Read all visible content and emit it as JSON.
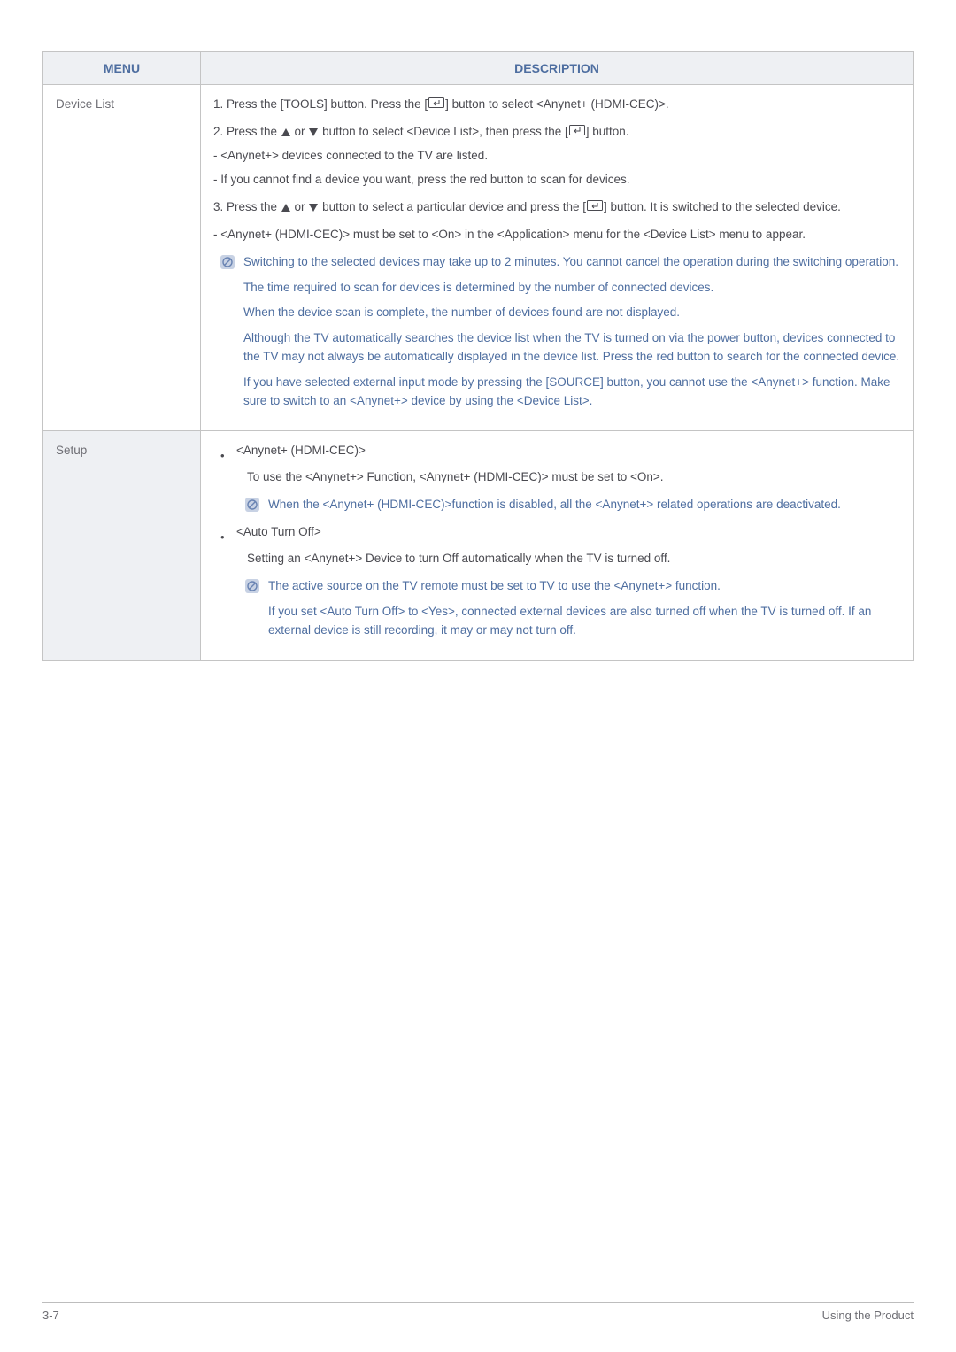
{
  "table": {
    "header": {
      "menu": "MENU",
      "description": "DESCRIPTION"
    },
    "rows": [
      {
        "menu": "Device List",
        "p1a": "1. Press the [TOOLS] button. Press the [",
        "p1b": "] button to select <Anynet+ (HDMI-CEC)>.",
        "p2a": "2. Press the ",
        "p2b": " or ",
        "p2c": " button to select <Device List>, then press the [",
        "p2d": "] button.",
        "p3": " - <Anynet+> devices connected to the TV are listed.",
        "p4": " - If you cannot find a device you want, press the red button to scan for devices.",
        "p5a": "3. Press the ",
        "p5b": " or ",
        "p5c": " button to select a particular device and press the [",
        "p5d": "] button. It is switched to the selected device.",
        "p6": " - <Anynet+ (HDMI-CEC)> must be set to <On> in the <Application> menu for the <Device List> menu to appear.",
        "n1": "Switching to the selected devices may take up to 2 minutes. You cannot cancel the operation during the switching operation.",
        "n2": "The time required to scan for devices is determined by the number of connected devices.",
        "n3": "When the device scan is complete, the number of devices found are not displayed.",
        "n4": "Although the TV automatically searches the device list when the TV is turned on via the power button, devices connected to the TV may not always be automatically displayed in the device list. Press the red button to search for the connected device.",
        "n5": "If you have selected external input mode by pressing the [SOURCE] button, you cannot use the <Anynet+> function. Make sure to switch to an <Anynet+> device by using the <Device List>."
      },
      {
        "menu": "Setup",
        "b1_title": "<Anynet+ (HDMI-CEC)>",
        "b1_sub": "To use the <Anynet+> Function, <Anynet+ (HDMI-CEC)> must be set to <On>.",
        "b1_note": "When the <Anynet+ (HDMI-CEC)>function is disabled, all the <Anynet+> related operations are deactivated.",
        "b2_title": "<Auto Turn Off>",
        "b2_sub": "Setting an <Anynet+> Device to turn Off automatically when the TV is turned off.",
        "b2_note1": "The active source on the TV remote must be set to TV to use the <Anynet+> function.",
        "b2_note2": "If you set <Auto Turn Off> to <Yes>, connected external devices are also turned off when the TV is turned off. If an external device is still recording, it may or may not turn off."
      }
    ]
  },
  "footer": {
    "left": "3-7",
    "right": "Using the Product"
  }
}
